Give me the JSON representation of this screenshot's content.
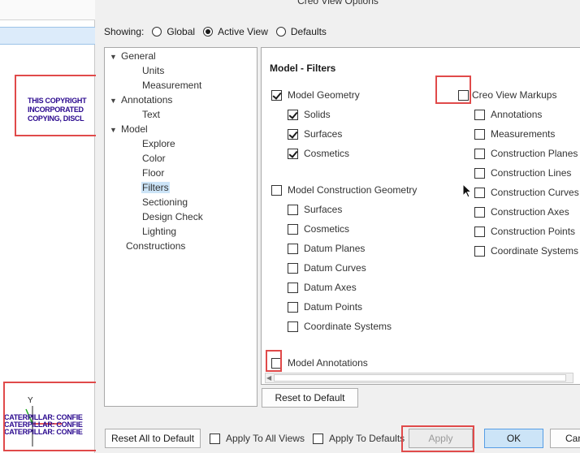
{
  "background": {
    "copyright_lines": [
      "THIS COPYRIGHT",
      "INCORPORATED",
      "COPYING, DISCL"
    ],
    "axis_label": "Y",
    "footer_lines": [
      "CATERPILLAR: CONFIE",
      "CATERPILLAR: CONFIE",
      "CATERPILLAR: CONFIE"
    ]
  },
  "dialog": {
    "title": "Creo View Options",
    "showing_label": "Showing:",
    "showing_options": [
      {
        "label": "Global",
        "selected": false
      },
      {
        "label": "Active View",
        "selected": true
      },
      {
        "label": "Defaults",
        "selected": false
      }
    ]
  },
  "tree": [
    {
      "label": "General",
      "expandable": true,
      "selected": false
    },
    {
      "label": "Units",
      "expandable": false,
      "selected": false
    },
    {
      "label": "Measurement",
      "expandable": false,
      "selected": false
    },
    {
      "label": "Annotations",
      "expandable": true,
      "selected": false
    },
    {
      "label": "Text",
      "expandable": false,
      "selected": false
    },
    {
      "label": "Model",
      "expandable": true,
      "selected": false
    },
    {
      "label": "Explore",
      "expandable": false,
      "selected": false
    },
    {
      "label": "Color",
      "expandable": false,
      "selected": false
    },
    {
      "label": "Floor",
      "expandable": false,
      "selected": false
    },
    {
      "label": "Filters",
      "expandable": false,
      "selected": true
    },
    {
      "label": "Sectioning",
      "expandable": false,
      "selected": false
    },
    {
      "label": "Design Check",
      "expandable": false,
      "selected": false
    },
    {
      "label": "Lighting",
      "expandable": false,
      "selected": false
    },
    {
      "label": "Constructions",
      "expandable": false,
      "selected": false
    }
  ],
  "filters": {
    "title": "Model - Filters",
    "left": [
      {
        "label": "Model Geometry",
        "checked": true
      },
      {
        "label": "Solids",
        "checked": true
      },
      {
        "label": "Surfaces",
        "checked": true
      },
      {
        "label": "Cosmetics",
        "checked": true
      },
      {
        "label": "Model Construction Geometry",
        "checked": false
      },
      {
        "label": "Surfaces",
        "checked": false
      },
      {
        "label": "Cosmetics",
        "checked": false
      },
      {
        "label": "Datum Planes",
        "checked": false
      },
      {
        "label": "Datum Curves",
        "checked": false
      },
      {
        "label": "Datum Axes",
        "checked": false
      },
      {
        "label": "Datum Points",
        "checked": false
      },
      {
        "label": "Coordinate Systems",
        "checked": false
      },
      {
        "label": "Model Annotations",
        "checked": false
      }
    ],
    "right": [
      {
        "label": "Creo View Markups",
        "checked": false
      },
      {
        "label": "Annotations",
        "checked": false
      },
      {
        "label": "Measurements",
        "checked": false
      },
      {
        "label": "Construction Planes",
        "checked": false
      },
      {
        "label": "Construction Lines",
        "checked": false
      },
      {
        "label": "Construction Curves",
        "checked": false
      },
      {
        "label": "Construction Axes",
        "checked": false
      },
      {
        "label": "Construction Points",
        "checked": false
      },
      {
        "label": "Coordinate Systems",
        "checked": false
      }
    ]
  },
  "buttons": {
    "reset_default": "Reset to Default",
    "reset_all": "Reset All to Default",
    "apply_all_views": "Apply To All Views",
    "apply_defaults": "Apply To Defaults",
    "apply": "Apply",
    "ok": "OK",
    "cancel": "Can"
  },
  "colors": {
    "highlight": "#e04a4a",
    "selection": "#cce4f7",
    "note_text": "#2b0a8f"
  }
}
